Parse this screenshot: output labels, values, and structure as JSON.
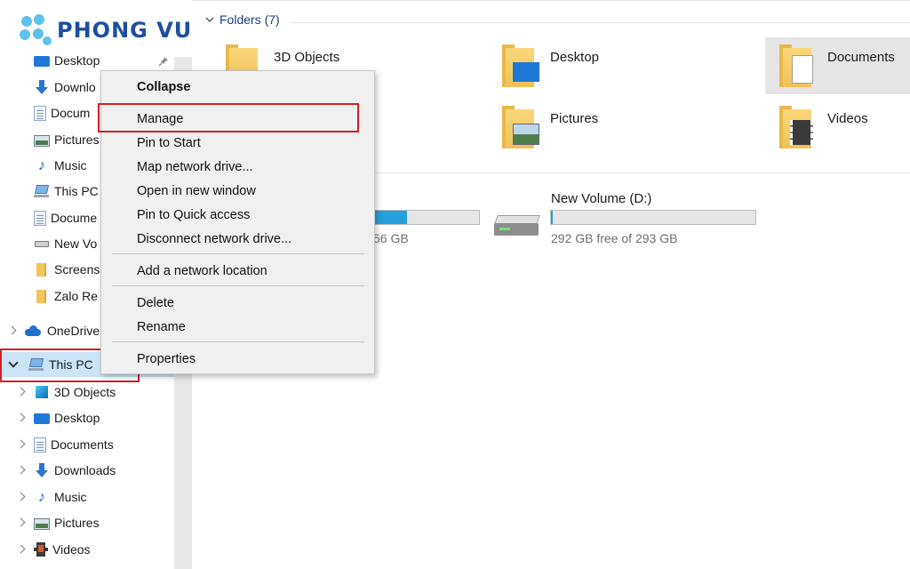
{
  "logo": {
    "text": "PHONG VU"
  },
  "nav": {
    "quick_access": [
      {
        "label": "Desktop",
        "icon": "desktop-icon",
        "pinned": true
      },
      {
        "label": "Downlo",
        "icon": "download-icon"
      },
      {
        "label": "Docum",
        "icon": "document-icon"
      },
      {
        "label": "Pictures",
        "icon": "pictures-icon"
      },
      {
        "label": "Music",
        "icon": "music-icon"
      },
      {
        "label": "This PC",
        "icon": "computer-icon"
      },
      {
        "label": "Docume",
        "icon": "document-icon"
      },
      {
        "label": "New Vo",
        "icon": "drive-icon"
      },
      {
        "label": "Screens",
        "icon": "folder-icon"
      },
      {
        "label": "Zalo Re",
        "icon": "folder-icon"
      }
    ],
    "onedrive": {
      "label": "OneDrive",
      "icon": "onedrive-icon"
    },
    "this_pc": {
      "label": "This PC",
      "icon": "computer-icon",
      "expanded": true
    },
    "this_pc_children": [
      {
        "label": "3D Objects",
        "icon": "3d-objects-icon"
      },
      {
        "label": "Desktop",
        "icon": "desktop-icon"
      },
      {
        "label": "Documents",
        "icon": "document-icon"
      },
      {
        "label": "Downloads",
        "icon": "download-icon"
      },
      {
        "label": "Music",
        "icon": "music-icon"
      },
      {
        "label": "Pictures",
        "icon": "pictures-icon"
      },
      {
        "label": "Videos",
        "icon": "videos-icon"
      }
    ]
  },
  "content": {
    "folders_header": "Folders (7)",
    "folders": [
      {
        "label": "3D Objects"
      },
      {
        "label": "Desktop"
      },
      {
        "label": "Documents",
        "selected": true
      },
      {
        "label": "Pictures"
      },
      {
        "label": "Videos"
      }
    ],
    "drives": [
      {
        "label": "",
        "free_text": "56 GB",
        "used_fraction": 0.49
      },
      {
        "label": "New Volume (D:)",
        "free_text": "292 GB free of 293 GB",
        "used_fraction": 0.01
      }
    ]
  },
  "context_menu": {
    "items": [
      {
        "label": "Collapse",
        "bold": true
      },
      {
        "label": "Manage",
        "highlighted": true
      },
      {
        "label": "Pin to Start"
      },
      {
        "label": "Map network drive..."
      },
      {
        "label": "Open in new window"
      },
      {
        "label": "Pin to Quick access"
      },
      {
        "label": "Disconnect network drive..."
      },
      {
        "label": "Add a network location"
      },
      {
        "label": "Delete"
      },
      {
        "label": "Rename"
      },
      {
        "label": "Properties"
      }
    ]
  },
  "colors": {
    "highlight_box": "#d32026",
    "drive_fill": "#26a0da",
    "menu_bg": "#f0f0f0",
    "logo_blue": "#1d4f9e"
  }
}
